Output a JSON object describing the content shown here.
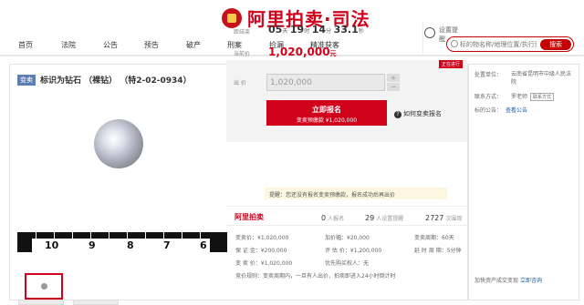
{
  "header": {
    "logo_text": "阿里拍卖·司法"
  },
  "nav": {
    "items": [
      "首页",
      "法院",
      "公告",
      "预告",
      "破产",
      "刑案",
      "捡漏",
      "精准获客"
    ],
    "search_placeholder": "标的物名称/地理位置/执行案号",
    "search_button": "搜索"
  },
  "item": {
    "badge": "变卖",
    "title": "标识为钻石 （裸钻） （特2-02-0934）",
    "ruler_numbers": [
      "10",
      "9",
      "8",
      "7",
      "6"
    ]
  },
  "info": {
    "countdown_label": "距结束",
    "cd_days": "05",
    "cd_days_unit": "天",
    "cd_hours": "19",
    "cd_hours_unit": "时",
    "cd_minutes": "14",
    "cd_minutes_unit": "分",
    "cd_seconds": "33.1",
    "cd_seconds_unit": "秒",
    "price_label": "当前价",
    "price": "1,020,000",
    "price_unit": "元",
    "remind_label": "设置提醒"
  },
  "bid": {
    "status": "正在进行",
    "label": "出 价",
    "value": "1,020,000",
    "plus": "+",
    "minus": "−",
    "signup_main": "立即报名",
    "signup_sub": "变卖预缴款 ¥1,020,000",
    "help": "如何变卖报名",
    "tip": "提醒：您还没有报名变卖预缴款，报名成功后再出价"
  },
  "stats": {
    "ali_logo": "阿里拍卖",
    "signups_n": "0",
    "signups_label": "人报名",
    "reminders_n": "29",
    "reminders_label": "人设置提醒",
    "views_n": "2727",
    "views_label": "次围观"
  },
  "details": [
    "变卖价：¥1,020,000",
    "加价幅：¥20,000",
    "变卖周期：60天",
    "保 证 金：¥200,000",
    "评 估 价：¥1,200,000",
    "延 时 周 期：5分钟",
    "变 卖 价：¥1,020,000",
    "优先购买权人：无",
    ""
  ],
  "rules": "竞价规则：变卖周期内，一旦有人出价，拍卖即进入24小时倒计时",
  "sidebar": {
    "unit_label": "处置单位：",
    "unit_value": "云南省昆明市中级人民法院",
    "contact_label": "联系方式：",
    "contact_name": "罗老师",
    "contact_button": "联系方式",
    "notice_label": "标的公告：",
    "notice_link": "查看公告",
    "bottom_text": "加快资产成交变现",
    "bottom_link": "立即咨询"
  }
}
